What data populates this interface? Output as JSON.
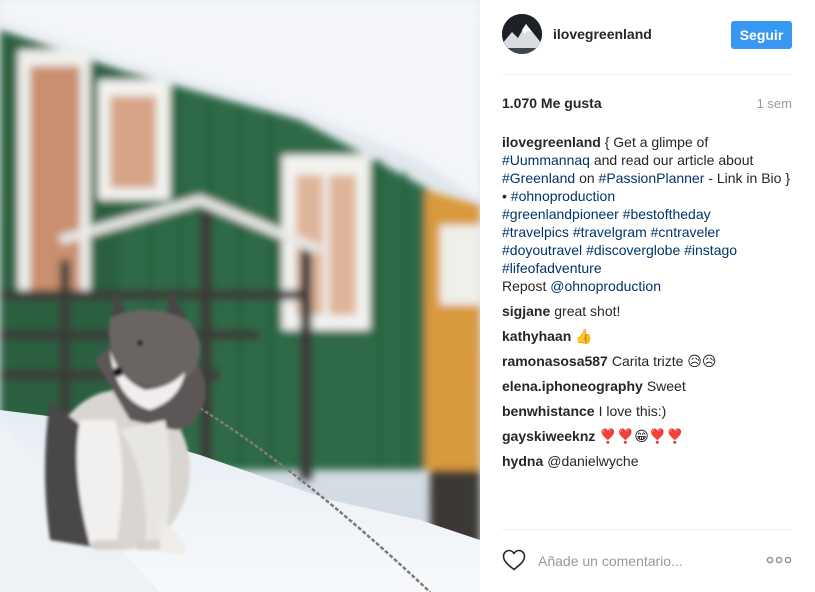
{
  "header": {
    "username": "ilovegreenland",
    "follow_label": "Seguir"
  },
  "stats": {
    "likes": "1.070 Me gusta",
    "time": "1 sem"
  },
  "caption": {
    "author": "ilovegreenland",
    "t1": "{ Get a glimpe of",
    "tag_uummannaq": "#Uummannaq",
    "t2": "and read our article about",
    "tag_greenland": "#Greenland",
    "t3": "on",
    "tag_passionplanner": "#PassionPlanner",
    "t4": "- Link in Bio } •",
    "tag_ohnoproduction": "#ohnoproduction",
    "tag_greenlandpioneer": "#greenlandpioneer",
    "tag_bestoftheday": "#bestoftheday",
    "tag_travelpics": "#travelpics",
    "tag_travelgram": "#travelgram",
    "tag_cntraveler": "#cntraveler",
    "tag_doyoutravel": "#doyoutravel",
    "tag_discoverglobe": "#discoverglobe",
    "tag_instago": "#instago",
    "tag_lifeofadventure": "#lifeofadventure",
    "t5": "Repost",
    "mention_ohnoproduction": "@ohnoproduction"
  },
  "comments": [
    {
      "user": "sigjane",
      "text": "great shot!"
    },
    {
      "user": "kathyhaan",
      "text": "👍"
    },
    {
      "user": "ramonasosa587",
      "text": "Carita trizte 😥😥"
    },
    {
      "user": "elena.iphoneography",
      "text": "Sweet"
    },
    {
      "user": "benwhistance",
      "text": "I love this:)"
    },
    {
      "user": "gayskiweeknz",
      "text": "❣️❣️😁❣️❣️"
    },
    {
      "user": "hydna",
      "text": "@danielwyche"
    }
  ],
  "footer": {
    "comment_placeholder": "Añade un comentario..."
  },
  "icons": {
    "like": "heart-outline-icon",
    "more": "more-options-icon"
  },
  "colors": {
    "accent": "#3897f0",
    "link": "#003569",
    "muted": "#999999"
  }
}
